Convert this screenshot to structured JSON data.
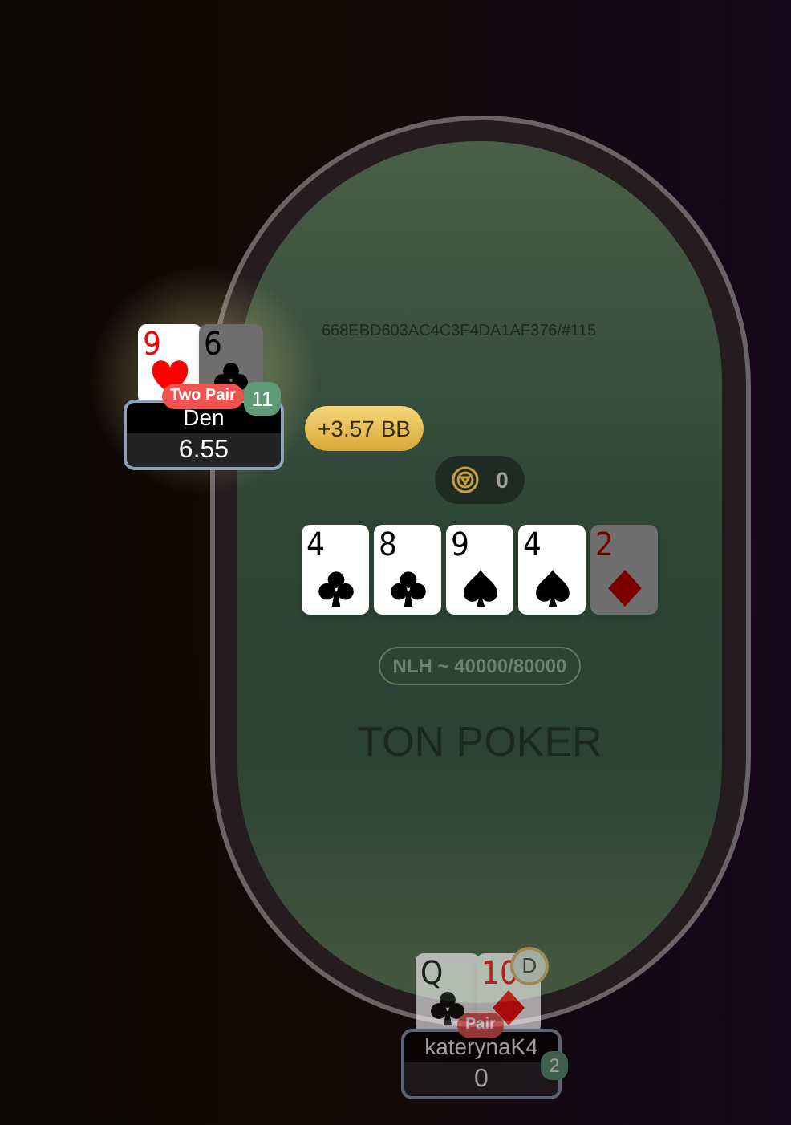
{
  "table": {
    "hand_id": "668EBD603AC4C3F4DA1AF376/#115",
    "pot": "0",
    "stakes": "NLH ~ 40000/80000",
    "watermark": "TON POKER",
    "board": [
      {
        "rank": "4",
        "kind": "clubs",
        "dimmed": false
      },
      {
        "rank": "8",
        "kind": "clubs",
        "dimmed": false
      },
      {
        "rank": "9",
        "kind": "spades",
        "dimmed": false
      },
      {
        "rank": "4",
        "kind": "spades",
        "dimmed": false
      },
      {
        "rank": "2",
        "kind": "diamonds",
        "dimmed": true
      }
    ]
  },
  "players": [
    {
      "name": "Den",
      "stack": "6.55",
      "hand": "Two Pair",
      "count": "11",
      "bet": "+3.57 BB",
      "active": true,
      "dealer": false,
      "cards": [
        {
          "rank": "9",
          "kind": "hearts",
          "dimmed": false
        },
        {
          "rank": "6",
          "kind": "clubs",
          "dimmed": true
        }
      ]
    },
    {
      "name": "katerynaK4",
      "stack": "0",
      "hand": "Pair",
      "count": "2",
      "active": false,
      "dealer": true,
      "dealer_label": "D",
      "cards": [
        {
          "rank": "Q",
          "kind": "clubs",
          "dimmed": false
        },
        {
          "rank": "10",
          "kind": "diamonds",
          "dimmed": false
        }
      ]
    }
  ]
}
